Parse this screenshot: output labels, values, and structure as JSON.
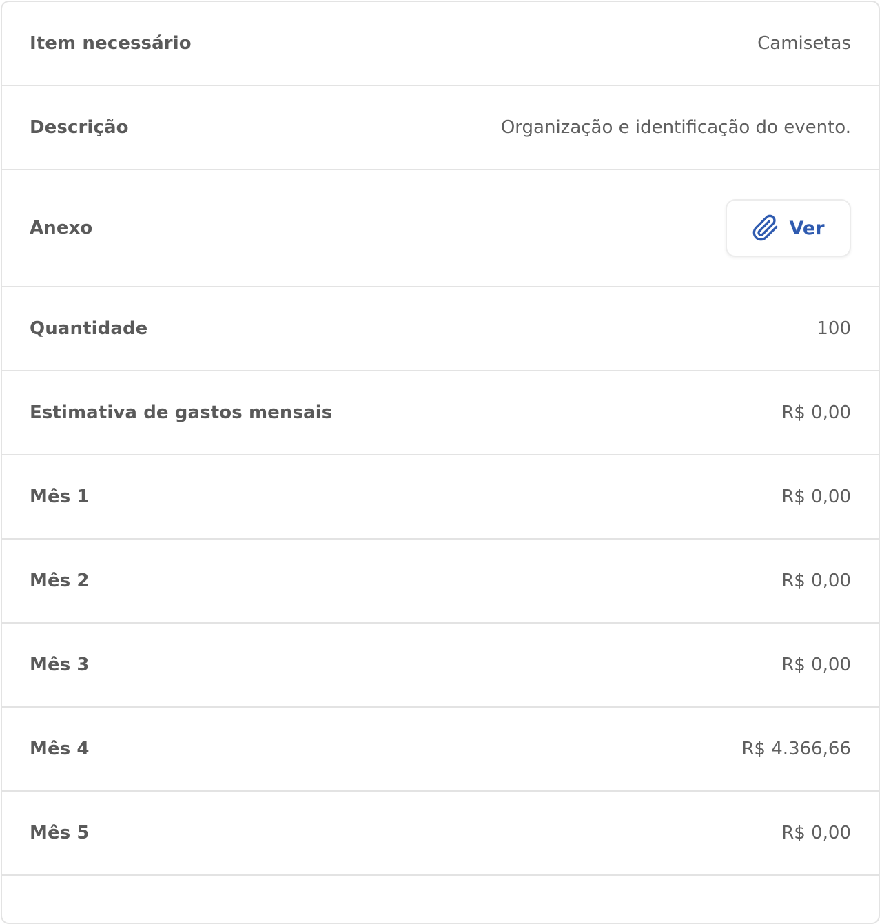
{
  "colors": {
    "accent": "#2f5bb0",
    "label": "#5a5a5a",
    "border": "#e3e3e3"
  },
  "rows": {
    "item": {
      "label": "Item necessário",
      "value": "Camisetas"
    },
    "descricao": {
      "label": "Descrição",
      "value": "Organização e identificação do evento."
    },
    "anexo": {
      "label": "Anexo",
      "button_label": "Ver",
      "icon": "paperclip-icon"
    },
    "quantidade": {
      "label": "Quantidade",
      "value": "100"
    },
    "estimativa": {
      "label": "Estimativa de gastos mensais",
      "value": "R$ 0,00"
    },
    "mes1": {
      "label": "Mês 1",
      "value": "R$ 0,00"
    },
    "mes2": {
      "label": "Mês 2",
      "value": "R$ 0,00"
    },
    "mes3": {
      "label": "Mês 3",
      "value": "R$ 0,00"
    },
    "mes4": {
      "label": "Mês 4",
      "value": "R$ 4.366,66"
    },
    "mes5": {
      "label": "Mês 5",
      "value": "R$ 0,00"
    }
  }
}
